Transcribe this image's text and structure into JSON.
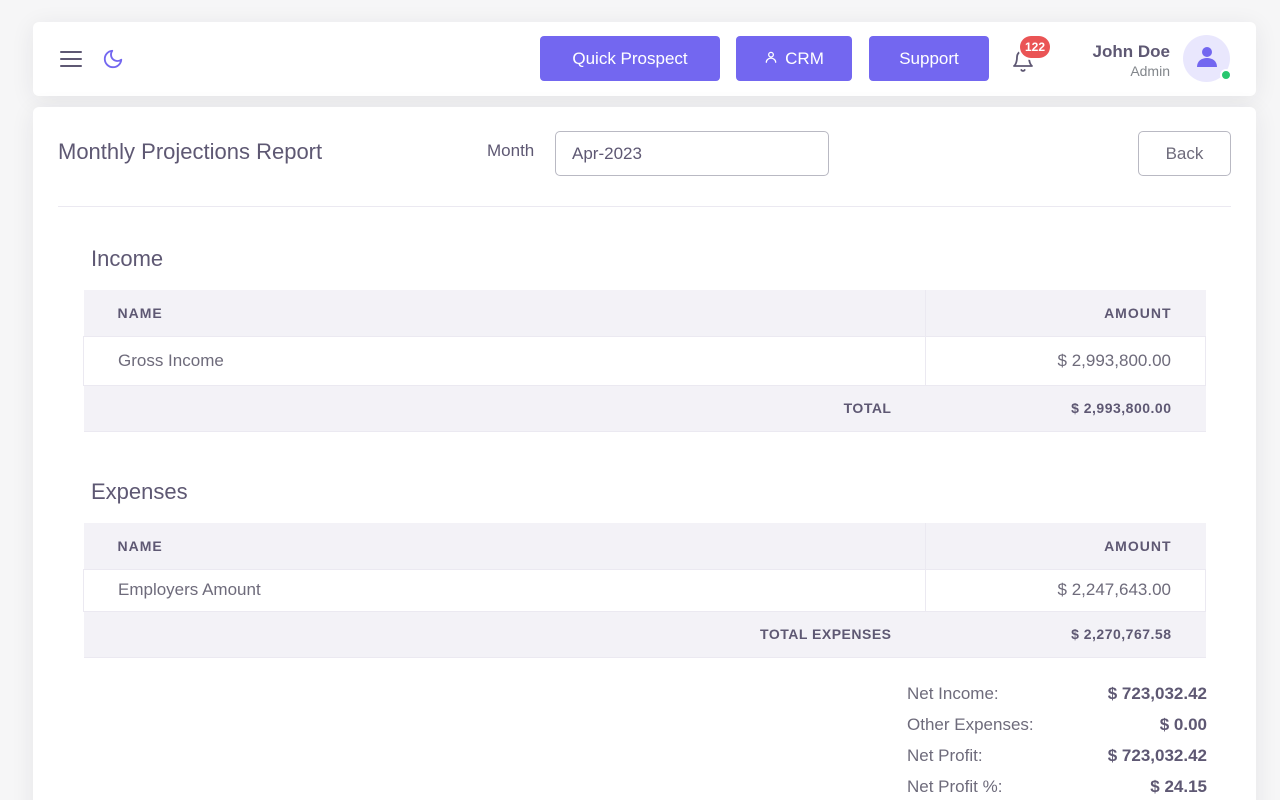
{
  "header": {
    "buttons": {
      "quick_prospect": "Quick Prospect",
      "crm": "CRM",
      "support": "Support"
    },
    "notifications_count": "122",
    "user": {
      "name": "John Doe",
      "role": "Admin"
    },
    "icons": {
      "menu": "menu-icon",
      "theme": "moon-icon",
      "bell": "bell-icon",
      "avatar": "user-icon",
      "crm": "user-outline-icon"
    },
    "colors": {
      "primary": "#7367f0",
      "badge": "#ea5455",
      "online": "#28c76f"
    }
  },
  "report": {
    "title": "Monthly Projections Report",
    "month_label": "Month",
    "month_value": "Apr-2023",
    "back_label": "Back"
  },
  "income": {
    "title": "Income",
    "columns": {
      "name": "NAME",
      "amount": "AMOUNT"
    },
    "rows": [
      {
        "name": "Gross Income",
        "amount": "$ 2,993,800.00"
      }
    ],
    "total_label": "TOTAL",
    "total_value": "$ 2,993,800.00"
  },
  "expenses": {
    "title": "Expenses",
    "columns": {
      "name": "NAME",
      "amount": "AMOUNT"
    },
    "rows": [
      {
        "name": "Employers Amount",
        "amount": "$ 2,247,643.00"
      }
    ],
    "total_label": "TOTAL EXPENSES",
    "total_value": "$ 2,270,767.58"
  },
  "summary": {
    "net_income_label": "Net Income:",
    "net_income_value": "$ 723,032.42",
    "other_expenses_label": "Other Expenses:",
    "other_expenses_value": "$ 0.00",
    "net_profit_label": "Net Profit:",
    "net_profit_value": "$ 723,032.42",
    "net_profit_pct_label": "Net Profit %:",
    "net_profit_pct_value": "$ 24.15"
  }
}
